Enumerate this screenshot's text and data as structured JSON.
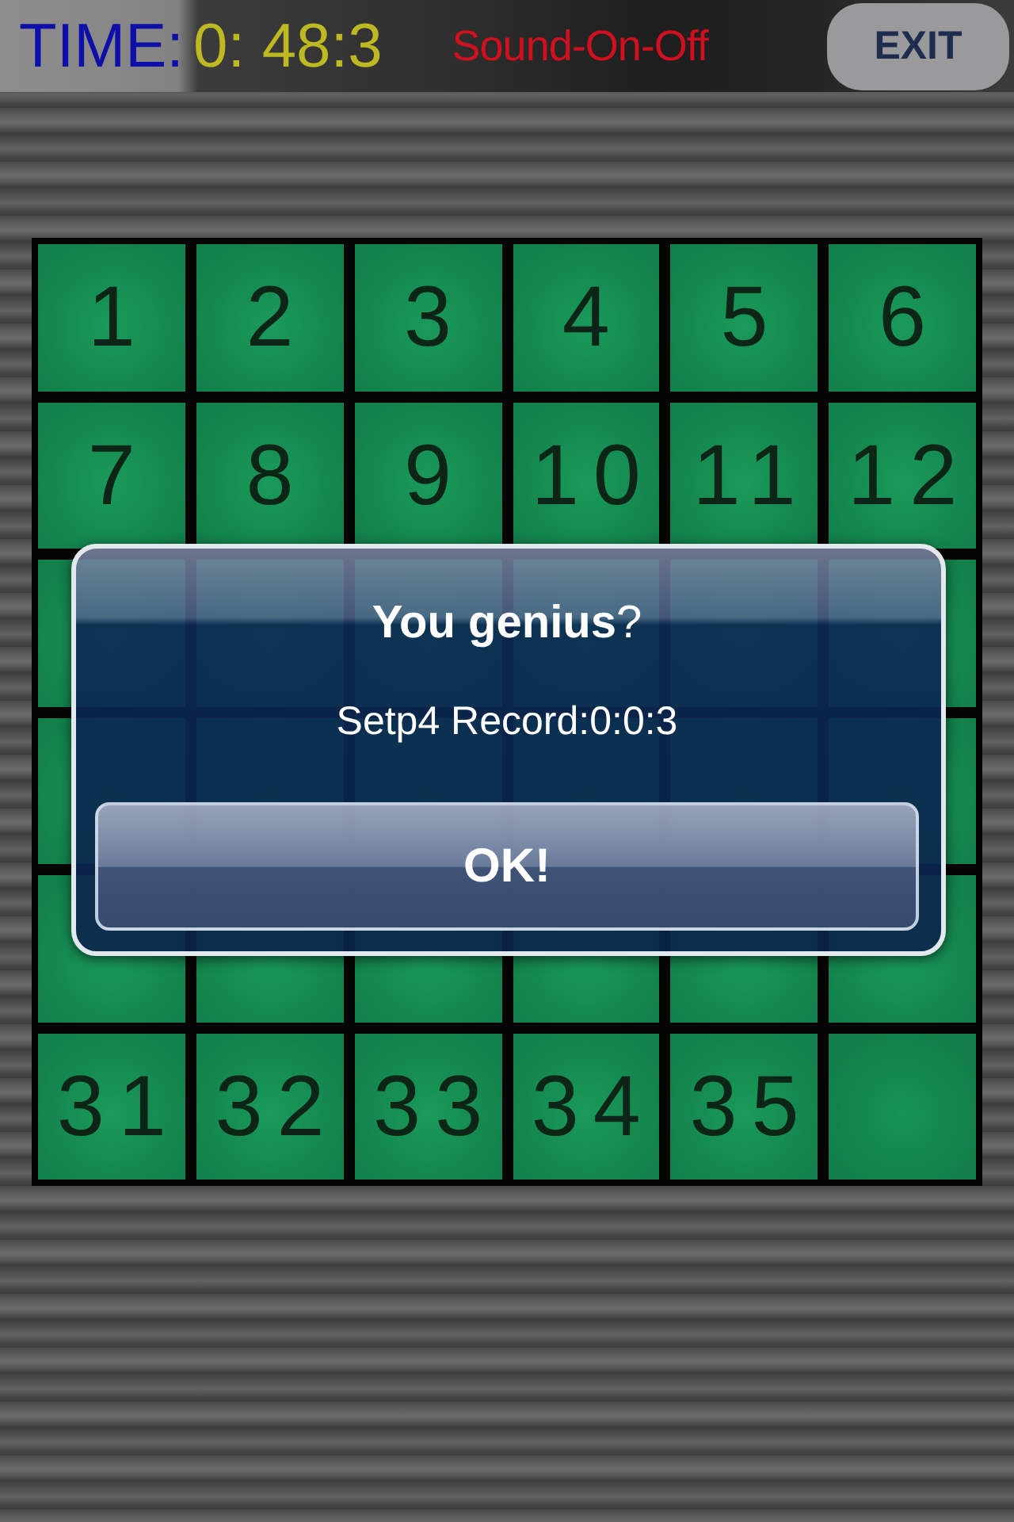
{
  "status_bar": {
    "time_label": "TIME:",
    "time_value": "0: 48:3",
    "sound_toggle": "Sound-On-Off",
    "exit_button": "EXIT"
  },
  "board": {
    "tiles": [
      {
        "kind": "number",
        "label": "1"
      },
      {
        "kind": "number",
        "label": "2"
      },
      {
        "kind": "number",
        "label": "3"
      },
      {
        "kind": "number",
        "label": "4"
      },
      {
        "kind": "number",
        "label": "5"
      },
      {
        "kind": "number",
        "label": "6"
      },
      {
        "kind": "number",
        "label": "7"
      },
      {
        "kind": "number",
        "label": "8"
      },
      {
        "kind": "number",
        "label": "9"
      },
      {
        "kind": "number",
        "label": "10"
      },
      {
        "kind": "number",
        "label": "11"
      },
      {
        "kind": "number",
        "label": "12"
      },
      {
        "kind": "covered"
      },
      {
        "kind": "covered"
      },
      {
        "kind": "covered"
      },
      {
        "kind": "covered"
      },
      {
        "kind": "covered"
      },
      {
        "kind": "covered"
      },
      {
        "kind": "covered"
      },
      {
        "kind": "covered"
      },
      {
        "kind": "covered"
      },
      {
        "kind": "covered"
      },
      {
        "kind": "covered"
      },
      {
        "kind": "covered"
      },
      {
        "kind": "covered"
      },
      {
        "kind": "covered"
      },
      {
        "kind": "covered"
      },
      {
        "kind": "covered"
      },
      {
        "kind": "covered"
      },
      {
        "kind": "covered"
      },
      {
        "kind": "number",
        "label": "31"
      },
      {
        "kind": "number",
        "label": "32"
      },
      {
        "kind": "number",
        "label": "33"
      },
      {
        "kind": "number",
        "label": "34"
      },
      {
        "kind": "number",
        "label": "35"
      },
      {
        "kind": "empty"
      }
    ]
  },
  "alert": {
    "title": "**You genius**?",
    "message": "Setp4 Record:0:0:3",
    "button": "OK!"
  }
}
